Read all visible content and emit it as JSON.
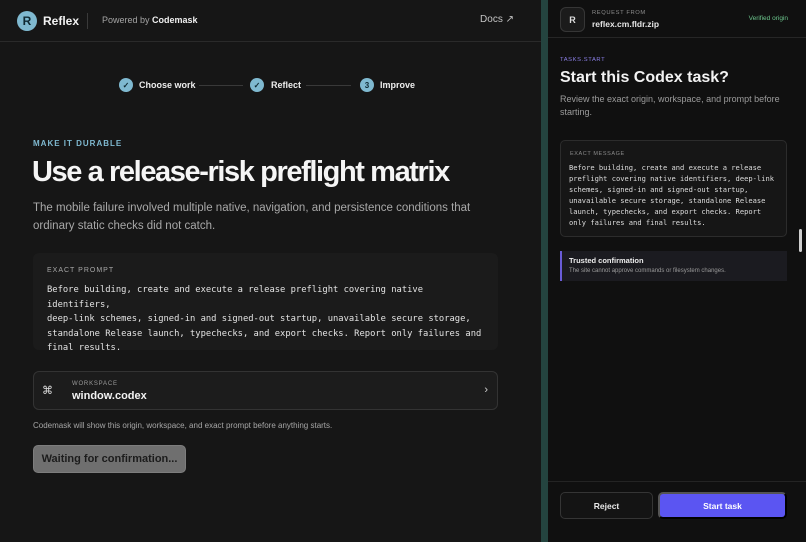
{
  "header": {
    "logo_letter": "R",
    "brand": "Reflex",
    "powered_prefix": "Powered by",
    "powered_name": "Codemask",
    "docs_label": "Docs ↗"
  },
  "steps": [
    {
      "label": "Choose work",
      "marker": "✓",
      "state": "complete"
    },
    {
      "label": "Reflect",
      "marker": "✓",
      "state": "complete"
    },
    {
      "label": "Improve",
      "marker": "3",
      "state": "current"
    }
  ],
  "main": {
    "eyebrow": "MAKE IT DURABLE",
    "title": "Use a release-risk preflight matrix",
    "lede": "The mobile failure involved multiple native, navigation, and persistence conditions that ordinary static checks did not catch.",
    "prompt_label": "EXACT PROMPT",
    "prompt_text": "Before building, create and execute a release preflight covering native identifiers,\ndeep-link schemes, signed-in and signed-out startup, unavailable secure storage,\nstandalone Release launch, typechecks, and export checks. Report only failures and\nfinal results.",
    "workspace_icon": "⌘",
    "workspace_label": "WORKSPACE",
    "workspace_value": "window.codex",
    "workspace_chevron": "›",
    "note": "Codemask will show this origin, workspace, and exact prompt before anything starts.",
    "waiting_label": "Waiting for confirmation..."
  },
  "panel": {
    "avatar_letter": "R",
    "request_label": "REQUEST FROM",
    "request_origin": "reflex.cm.fldr.zip",
    "verified_label": "Verified origin",
    "task_eyebrow": "TASKS.START",
    "task_title": "Start this Codex task?",
    "task_subtitle": "Review the exact origin, workspace, and prompt before starting.",
    "message_label": "EXACT MESSAGE",
    "message_text": "Before building, create and execute a release\npreflight covering native identifiers, deep-link\nschemes, signed-in and signed-out startup,\nunavailable secure storage, standalone Release\nlaunch, typechecks, and export checks. Report\nonly failures and final results.",
    "trusted_title": "Trusted confirmation",
    "trusted_body": "The site cannot approve commands or filesystem changes.",
    "reject_label": "Reject",
    "start_label": "Start task"
  },
  "colors": {
    "accent_blue": "#7fb9d0",
    "accent_purple": "#5b55f2",
    "verified_green": "#6cc48c"
  }
}
